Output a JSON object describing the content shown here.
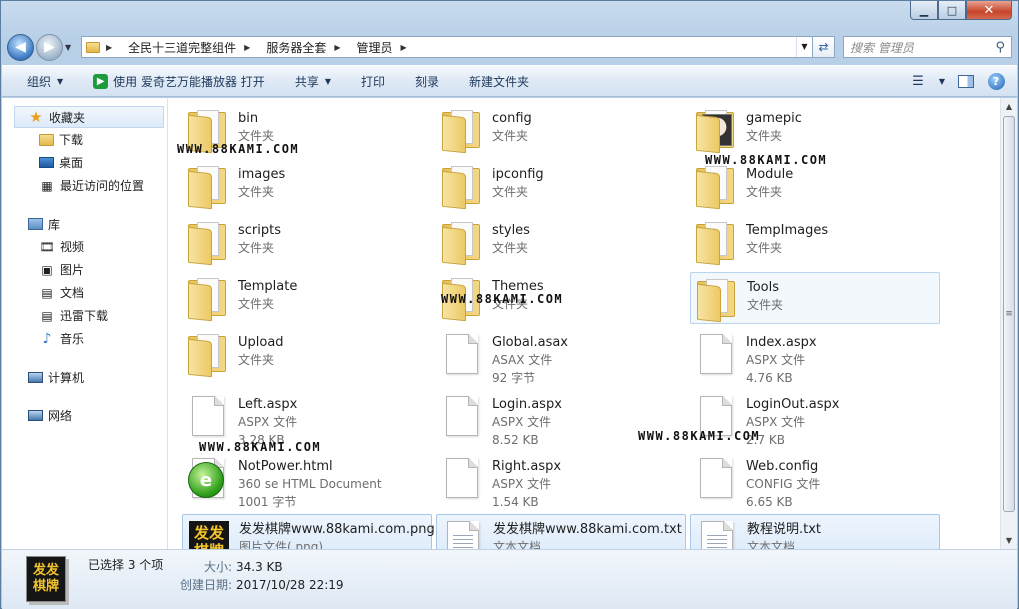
{
  "window": {
    "min_label": "▁",
    "max_label": "□",
    "close_label": "✕"
  },
  "address": {
    "crumbs": [
      "全民十三道完整组件",
      "服务器全套",
      "管理员"
    ],
    "search_placeholder": "搜索 管理员"
  },
  "toolbar": {
    "organize": "组织",
    "open_with": "使用 爱奇艺万能播放器 打开",
    "share": "共享",
    "print": "打印",
    "burn": "刻录",
    "new_folder": "新建文件夹"
  },
  "sidebar": {
    "favorites": "收藏夹",
    "downloads": "下载",
    "desktop": "桌面",
    "recent": "最近访问的位置",
    "libraries": "库",
    "videos": "视频",
    "pictures": "图片",
    "documents": "文档",
    "thunder": "迅雷下载",
    "music": "音乐",
    "computer": "计算机",
    "network": "网络"
  },
  "files": [
    {
      "name": "bin",
      "type": "文件夹",
      "size": "",
      "icon": "folder"
    },
    {
      "name": "config",
      "type": "文件夹",
      "size": "",
      "icon": "folder"
    },
    {
      "name": "gamepic",
      "type": "文件夹",
      "size": "",
      "icon": "folder-image"
    },
    {
      "name": "images",
      "type": "文件夹",
      "size": "",
      "icon": "folder"
    },
    {
      "name": "ipconfig",
      "type": "文件夹",
      "size": "",
      "icon": "folder"
    },
    {
      "name": "Module",
      "type": "文件夹",
      "size": "",
      "icon": "folder"
    },
    {
      "name": "scripts",
      "type": "文件夹",
      "size": "",
      "icon": "folder"
    },
    {
      "name": "styles",
      "type": "文件夹",
      "size": "",
      "icon": "folder"
    },
    {
      "name": "TempImages",
      "type": "文件夹",
      "size": "",
      "icon": "folder"
    },
    {
      "name": "Template",
      "type": "文件夹",
      "size": "",
      "icon": "folder"
    },
    {
      "name": "Themes",
      "type": "文件夹",
      "size": "",
      "icon": "folder"
    },
    {
      "name": "Tools",
      "type": "文件夹",
      "size": "",
      "icon": "folder"
    },
    {
      "name": "Upload",
      "type": "文件夹",
      "size": "",
      "icon": "folder"
    },
    {
      "name": "Global.asax",
      "type": "ASAX 文件",
      "size": "92 字节",
      "icon": "document"
    },
    {
      "name": "Index.aspx",
      "type": "ASPX 文件",
      "size": "4.76 KB",
      "icon": "document"
    },
    {
      "name": "Left.aspx",
      "type": "ASPX 文件",
      "size": "3.28 KB",
      "icon": "document"
    },
    {
      "name": "Login.aspx",
      "type": "ASPX 文件",
      "size": "8.52 KB",
      "icon": "document"
    },
    {
      "name": "LoginOut.aspx",
      "type": "ASPX 文件",
      "size": "2.7 KB",
      "icon": "document"
    },
    {
      "name": "NotPower.html",
      "type": "360 se HTML Document",
      "size": "1001 字节",
      "icon": "html"
    },
    {
      "name": "Right.aspx",
      "type": "ASPX 文件",
      "size": "1.54 KB",
      "icon": "document"
    },
    {
      "name": "Web.config",
      "type": "CONFIG 文件",
      "size": "6.65 KB",
      "icon": "document"
    },
    {
      "name": "发发棋牌www.88kami.com.png",
      "type": "图片文件(.png)",
      "size": "",
      "icon": "png"
    },
    {
      "name": "发发棋牌www.88kami.com.txt",
      "type": "文本文档",
      "size": "",
      "icon": "text"
    },
    {
      "name": "教程说明.txt",
      "type": "文本文档",
      "size": "",
      "icon": "text"
    }
  ],
  "watermark": "WWW.88KAMI.COM",
  "png_thumb_text": "发发\n棋牌",
  "details": {
    "selected": "已选择 3 个项",
    "size_label": "大小:",
    "size_value": "34.3 KB",
    "date_label": "创建日期:",
    "date_value": "2017/10/28 22:19"
  }
}
